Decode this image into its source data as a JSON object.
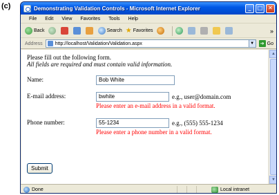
{
  "figure_label": "(c)",
  "window": {
    "title": "Demonstrating Validation Controls - Microsoft Internet Explorer",
    "minimize": "_",
    "maximize": "□",
    "close": "✕"
  },
  "menu": [
    "File",
    "Edit",
    "View",
    "Favorites",
    "Tools",
    "Help"
  ],
  "toolbar": {
    "back": "Back",
    "search": "Search",
    "favorites": "Favorites",
    "more": "»"
  },
  "address": {
    "label": "Address",
    "url": "http://localhost/Validation/Validation.aspx",
    "go": "Go"
  },
  "page": {
    "intro": "Please fill out the following form.",
    "note": "All fields are required and must contain valid information.",
    "name_label": "Name:",
    "name_value": "Bob White",
    "email_label": "E-mail address:",
    "email_value": "bwhite",
    "email_hint": "e.g., user@domain.com",
    "email_error": "Please enter an e-mail address in a valid format.",
    "phone_label": "Phone number:",
    "phone_value": "55-1234",
    "phone_hint": "e.g., (555) 555-1234",
    "phone_error": "Please enter a phone number in a valid format.",
    "submit": "Submit"
  },
  "status": {
    "text": "Done",
    "zone": "Local intranet"
  },
  "colors": {
    "error": "#ff0000",
    "titlebar": "#0058e6"
  }
}
